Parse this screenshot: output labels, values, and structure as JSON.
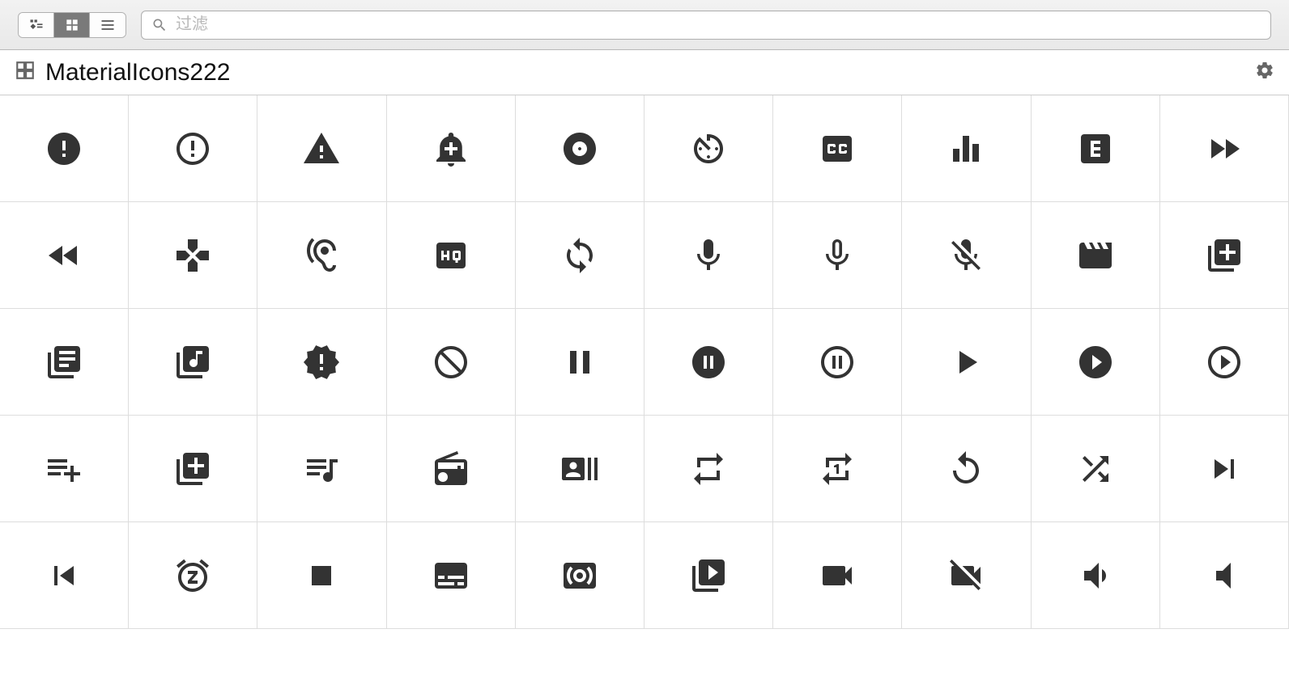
{
  "toolbar": {
    "search_placeholder": "过滤",
    "view_modes": [
      "outline",
      "grid",
      "list"
    ],
    "active_view": "grid"
  },
  "page": {
    "title": "MaterialIcons222"
  },
  "icons": [
    {
      "name": "error-filled"
    },
    {
      "name": "error-outline"
    },
    {
      "name": "warning"
    },
    {
      "name": "add-alert"
    },
    {
      "name": "album"
    },
    {
      "name": "av-timer"
    },
    {
      "name": "closed-caption"
    },
    {
      "name": "equalizer"
    },
    {
      "name": "explicit"
    },
    {
      "name": "fast-forward"
    },
    {
      "name": "fast-rewind"
    },
    {
      "name": "games"
    },
    {
      "name": "hearing"
    },
    {
      "name": "high-quality"
    },
    {
      "name": "loop"
    },
    {
      "name": "mic"
    },
    {
      "name": "mic-none"
    },
    {
      "name": "mic-off"
    },
    {
      "name": "movie"
    },
    {
      "name": "library-add"
    },
    {
      "name": "library-books"
    },
    {
      "name": "library-music"
    },
    {
      "name": "new-releases"
    },
    {
      "name": "not-interested"
    },
    {
      "name": "pause"
    },
    {
      "name": "pause-circle-filled"
    },
    {
      "name": "pause-circle-outline"
    },
    {
      "name": "play-arrow"
    },
    {
      "name": "play-circle-filled"
    },
    {
      "name": "play-circle-outline"
    },
    {
      "name": "playlist-add"
    },
    {
      "name": "queue"
    },
    {
      "name": "queue-music"
    },
    {
      "name": "radio"
    },
    {
      "name": "recent-actors"
    },
    {
      "name": "repeat"
    },
    {
      "name": "repeat-one"
    },
    {
      "name": "replay"
    },
    {
      "name": "shuffle"
    },
    {
      "name": "skip-next"
    },
    {
      "name": "skip-previous"
    },
    {
      "name": "snooze"
    },
    {
      "name": "stop"
    },
    {
      "name": "subtitles"
    },
    {
      "name": "surround-sound"
    },
    {
      "name": "video-library"
    },
    {
      "name": "videocam"
    },
    {
      "name": "videocam-off"
    },
    {
      "name": "volume-down"
    },
    {
      "name": "volume-mute"
    }
  ]
}
